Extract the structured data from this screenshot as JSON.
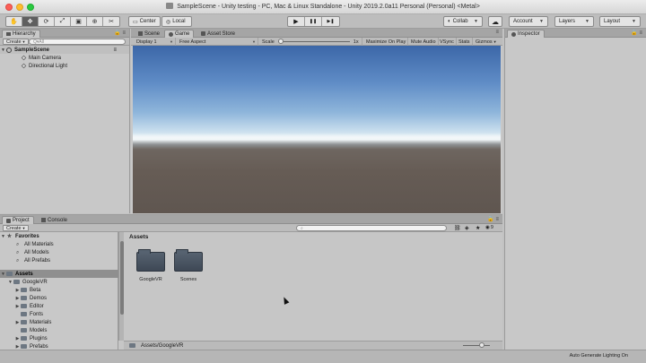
{
  "window": {
    "title": "SampleScene - Unity testing - PC, Mac & Linux Standalone - Unity 2019.2.0a11 Personal (Personal) <Metal>"
  },
  "toolbar": {
    "tools": [
      {
        "name": "hand-tool",
        "glyph": "✋"
      },
      {
        "name": "move-tool",
        "glyph": "✥"
      },
      {
        "name": "rotate-tool",
        "glyph": "⟳"
      },
      {
        "name": "scale-tool",
        "glyph": "⤢"
      },
      {
        "name": "rect-tool",
        "glyph": "▣"
      },
      {
        "name": "transform-tool",
        "glyph": "⊕"
      },
      {
        "name": "custom-tool",
        "glyph": "✂"
      }
    ],
    "pivot_label": "Center",
    "space_label": "Local",
    "play_glyph": "▶",
    "pause_glyph": "❚❚",
    "step_glyph": "▶❚",
    "collab_label": "Collab",
    "cloud_glyph": "☁",
    "account_label": "Account",
    "layers_label": "Layers",
    "layout_label": "Layout"
  },
  "hierarchy": {
    "tab_label": "Hierarchy",
    "create_label": "Create",
    "search_placeholder": "Q▾All",
    "scene_name": "SampleScene",
    "objects": [
      "Main Camera",
      "Directional Light"
    ]
  },
  "game_view": {
    "tabs": [
      "Scene",
      "Game",
      "Asset Store"
    ],
    "display_label": "Display 1",
    "aspect_label": "Free Aspect",
    "scale_label": "Scale",
    "scale_value": "1x",
    "buttons": [
      "Maximize On Play",
      "Mute Audio",
      "VSync",
      "Stats",
      "Gizmos"
    ]
  },
  "inspector": {
    "tab_label": "Inspector"
  },
  "project": {
    "tabs": [
      "Project",
      "Console"
    ],
    "create_label": "Create",
    "favorites_label": "Favorites",
    "favorites": [
      "All Materials",
      "All Models",
      "All Prefabs"
    ],
    "assets_label": "Assets",
    "googlevr_label": "GoogleVR",
    "googlevr_children": [
      "Beta",
      "Demos",
      "Editor",
      "Fonts",
      "Materials",
      "Models",
      "Plugins",
      "Prefabs"
    ],
    "breadcrumb": "Assets",
    "items": [
      "GoogleVR",
      "Scenes"
    ],
    "selected_path": "Assets/GoogleVR",
    "hidden_count": "9"
  },
  "status": {
    "message": "Auto Generate Lighting On"
  }
}
